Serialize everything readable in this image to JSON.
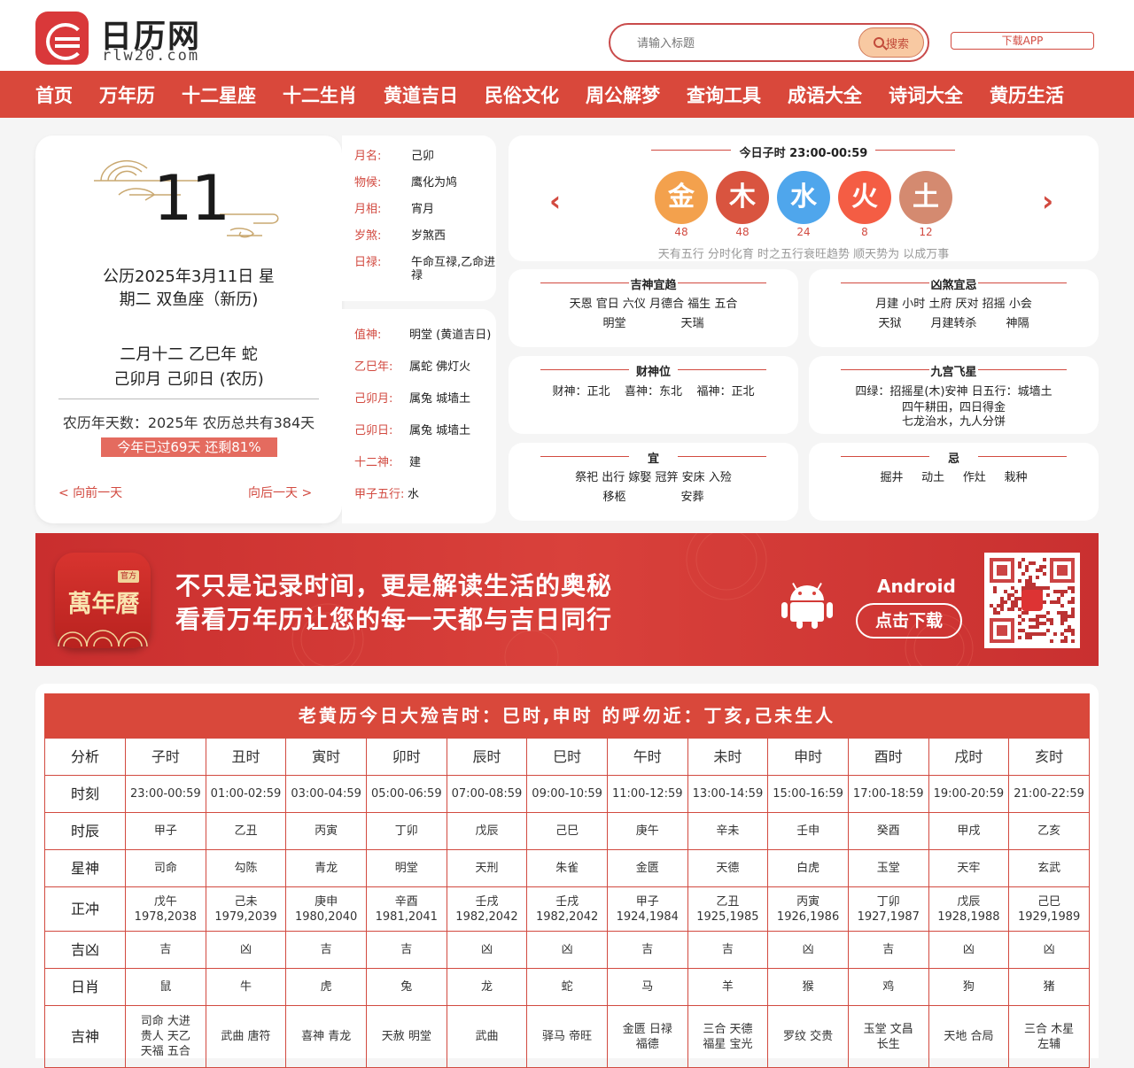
{
  "header": {
    "brand": "日历网",
    "domain": "rlw20.com",
    "search_placeholder": "请输入标题",
    "search_label": "搜索",
    "download_label": "下载APP"
  },
  "nav": [
    "首页",
    "万年历",
    "十二星座",
    "十二生肖",
    "黄道吉日",
    "民俗文化",
    "周公解梦",
    "查询工具",
    "成语大全",
    "诗词大全",
    "黄历生活"
  ],
  "date": {
    "day": "11",
    "gregorian_1": "公历2025年3月11日 星",
    "gregorian_2": "期二 双鱼座（新历)",
    "lunar_1": "二月十二 乙巳年 蛇",
    "lunar_2": "己卯月 己卯日 (农历)",
    "year_days": "农历年天数：2025年 农历总共有384天",
    "passed": "今年已过69天 还剩81%",
    "prev": "< 向前一天",
    "next": "向后一天 >"
  },
  "info_top": [
    {
      "k": "月名:",
      "v": "己卯"
    },
    {
      "k": "物候:",
      "v": "鹰化为鸠"
    },
    {
      "k": "月相:",
      "v": "宵月"
    },
    {
      "k": "岁煞:",
      "v": "岁煞西"
    },
    {
      "k": "日禄:",
      "v": "午命互禄,乙命进禄"
    }
  ],
  "info_bottom": [
    {
      "k": "值神:",
      "v": "明堂 (黄道吉日)"
    },
    {
      "k": "乙巳年:",
      "v": "属蛇 佛灯火"
    },
    {
      "k": "己卯月:",
      "v": "属兔 城墙土"
    },
    {
      "k": "己卯日:",
      "v": "属兔 城墙土"
    },
    {
      "k": "十二神:",
      "v": "建"
    },
    {
      "k": "甲子五行:",
      "v": "水"
    }
  ],
  "hour": {
    "title": "今日子时 23:00-00:59",
    "subtitle": "天有五行 分时化育 时之五行衰旺趋势 顺天势为 以成万事",
    "prev_icon": "chevron-left-icon",
    "next_icon": "chevron-right-icon",
    "elements": [
      {
        "char": "金",
        "val": "48",
        "color": "#f3a14d"
      },
      {
        "char": "木",
        "val": "48",
        "color": "#d9543f"
      },
      {
        "char": "水",
        "val": "24",
        "color": "#4fa6ec"
      },
      {
        "char": "火",
        "val": "8",
        "color": "#f45d44"
      },
      {
        "char": "土",
        "val": "12",
        "color": "#d48a70"
      }
    ]
  },
  "sections": {
    "jishen": {
      "title": "吉神宜趋",
      "line1": "天恩 官日 六仪 月德合 福生 五合",
      "line2": "明堂               天瑞"
    },
    "xiongsha": {
      "title": "凶煞宜忌",
      "line1": "月建 小时 土府 厌对 招摇 小会",
      "line2": "天狱        月建转杀        神隔"
    },
    "caishen": {
      "title": "财神位",
      "line1": "财神：正北    喜神：东北    福神：正北"
    },
    "jiugong": {
      "title": "九宫飞星",
      "line1": "四绿：招摇星(木)安神 日五行：城墙土",
      "line2": "四午耕田，四日得金",
      "line3": "七龙治水，九人分饼"
    },
    "yi": {
      "title": "宜",
      "line1": "祭祀 出行 嫁娶 冠笄 安床 入殓",
      "line2": "移柩               安葬"
    },
    "ji": {
      "title": "忌",
      "line1": "掘井     动土     作灶     栽种"
    }
  },
  "banner": {
    "app_name": "萬年曆",
    "tag": "官方",
    "line1": "不只是记录时间，更是解读生活的奥秘",
    "line2": "看看万年历让您的每一天都与吉日同行",
    "platform": "Android",
    "download": "点击下载"
  },
  "table": {
    "title": "老黄历今日大殓吉时：巳时,申时 的呼勿近：丁亥,己未生人",
    "header": [
      "分析",
      "子时",
      "丑时",
      "寅时",
      "卯时",
      "辰时",
      "巳时",
      "午时",
      "未时",
      "申时",
      "酉时",
      "戌时",
      "亥时"
    ],
    "rows": [
      {
        "label": "时刻",
        "cells": [
          "23:00-00:59",
          "01:00-02:59",
          "03:00-04:59",
          "05:00-06:59",
          "07:00-08:59",
          "09:00-10:59",
          "11:00-12:59",
          "13:00-14:59",
          "15:00-16:59",
          "17:00-18:59",
          "19:00-20:59",
          "21:00-22:59"
        ]
      },
      {
        "label": "时辰",
        "cells": [
          "甲子",
          "乙丑",
          "丙寅",
          "丁卯",
          "戊辰",
          "己巳",
          "庚午",
          "辛未",
          "壬申",
          "癸酉",
          "甲戌",
          "乙亥"
        ]
      },
      {
        "label": "星神",
        "cells": [
          "司命",
          "勾陈",
          "青龙",
          "明堂",
          "天刑",
          "朱雀",
          "金匮",
          "天德",
          "白虎",
          "玉堂",
          "天牢",
          "玄武"
        ]
      },
      {
        "label": "正冲",
        "cells": [
          "戊午\n1978,2038",
          "己未\n1979,2039",
          "庚申\n1980,2040",
          "辛酉\n1981,2041",
          "壬戌\n1982,2042",
          "壬戌\n1982,2042",
          "甲子\n1924,1984",
          "乙丑\n1925,1985",
          "丙寅\n1926,1986",
          "丁卯\n1927,1987",
          "戊辰\n1928,1988",
          "己巳\n1929,1989"
        ]
      },
      {
        "label": "吉凶",
        "cells": [
          "吉",
          "凶",
          "吉",
          "吉",
          "凶",
          "凶",
          "吉",
          "吉",
          "凶",
          "吉",
          "凶",
          "凶"
        ]
      },
      {
        "label": "日肖",
        "cells": [
          "鼠",
          "牛",
          "虎",
          "兔",
          "龙",
          "蛇",
          "马",
          "羊",
          "猴",
          "鸡",
          "狗",
          "猪"
        ]
      },
      {
        "label": "吉神",
        "cells": [
          "司命 大进\n贵人 天乙\n天福 五合",
          "武曲 唐符",
          "喜神 青龙",
          "天赦 明堂",
          "武曲",
          "驿马 帝旺",
          "金匮 日禄\n福德",
          "三合 天德\n福星 宝光",
          "罗纹 交贵",
          "玉堂 文昌\n长生",
          "天地 合局",
          "三合 木星\n左辅"
        ]
      }
    ]
  }
}
